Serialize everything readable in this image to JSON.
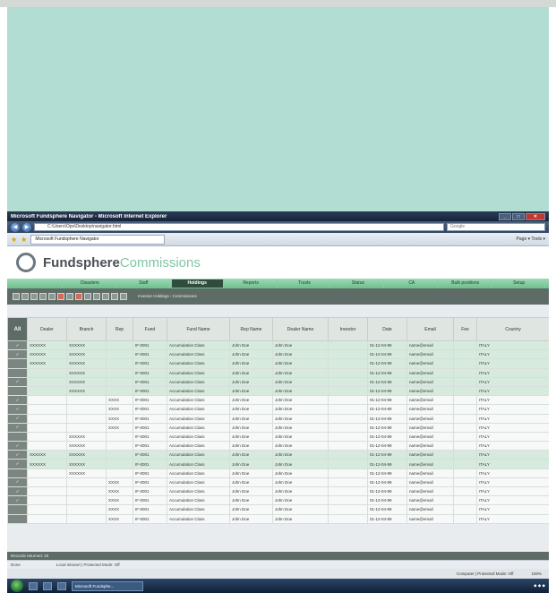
{
  "window": {
    "title": "Microsoft Fundsphere Navigator - Microsoft Internet Explorer",
    "address": "C:\\Users\\Ops\\Desktop\\navigator.html",
    "search_placeholder": "Google",
    "tab_label": "Microsoft Fundsphere Navigator",
    "tab_tools": "Page ▾  Tools ▾"
  },
  "app": {
    "brand_name": "Fundsphere",
    "brand_suffix": "Commissions",
    "menu": [
      "",
      "Disasters",
      "Staff",
      "Holdings",
      "Reports",
      "Trusts",
      "Status",
      "CA",
      "Bulk positions",
      "Setup"
    ],
    "active_menu": "Holdings",
    "breadcrumb": "Investor Holdings › Commissions"
  },
  "table": {
    "all_label": "All",
    "columns": [
      "Dealer",
      "Branch",
      "Rep",
      "Fund",
      "Fund Name",
      "Rep Name",
      "Dealer Name",
      "Investor",
      "Date",
      "Email",
      "Fee",
      "Country"
    ],
    "rows": [
      [
        "✓",
        "XXXXXX",
        "XXXXXX",
        "",
        "IF-0001",
        "Accumulation Class",
        "John Doe",
        "John Doe",
        "",
        "01-12-04-99",
        "name@email",
        "",
        "ITALY"
      ],
      [
        "✓",
        "XXXXXX",
        "XXXXXX",
        "",
        "IF-0001",
        "Accumulation Class",
        "John Doe",
        "John Doe",
        "",
        "01-12-04-99",
        "name@email",
        "",
        "ITALY"
      ],
      [
        "",
        "XXXXXX",
        "XXXXXX",
        "",
        "IF-0001",
        "Accumulation Class",
        "John Doe",
        "John Doe",
        "",
        "01-12-04-99",
        "name@email",
        "",
        "ITALY"
      ],
      [
        "",
        "",
        "XXXXXX",
        "",
        "IF-0001",
        "Accumulation Class",
        "John Doe",
        "John Doe",
        "",
        "01-12-04-99",
        "name@email",
        "",
        "ITALY"
      ],
      [
        "✓",
        "",
        "XXXXXX",
        "",
        "IF-0001",
        "Accumulation Class",
        "John Doe",
        "John Doe",
        "",
        "01-12-04-99",
        "name@email",
        "",
        "ITALY"
      ],
      [
        "",
        "",
        "XXXXXX",
        "",
        "IF-0001",
        "Accumulation Class",
        "John Doe",
        "John Doe",
        "",
        "01-12-04-99",
        "name@email",
        "",
        "ITALY"
      ],
      [
        "✓",
        "",
        "",
        "XXXX",
        "IF-0001",
        "Accumulation Class",
        "John Doe",
        "John Doe",
        "",
        "01-12-04-99",
        "name@email",
        "",
        "ITALY"
      ],
      [
        "✓",
        "",
        "",
        "XXXX",
        "IF-0001",
        "Accumulation Class",
        "John Doe",
        "John Doe",
        "",
        "01-12-04-99",
        "name@email",
        "",
        "ITALY"
      ],
      [
        "✓",
        "",
        "",
        "XXXX",
        "IF-0001",
        "Accumulation Class",
        "John Doe",
        "John Doe",
        "",
        "01-12-04-99",
        "name@email",
        "",
        "ITALY"
      ],
      [
        "✓",
        "",
        "",
        "XXXX",
        "IF-0001",
        "Accumulation Class",
        "John Doe",
        "John Doe",
        "",
        "01-12-04-99",
        "name@email",
        "",
        "ITALY"
      ],
      [
        "",
        "",
        "XXXXXX",
        "",
        "IF-0001",
        "Accumulation Class",
        "John Doe",
        "John Doe",
        "",
        "01-12-04-99",
        "name@email",
        "",
        "ITALY"
      ],
      [
        "✓",
        "",
        "XXXXXX",
        "",
        "IF-0001",
        "Accumulation Class",
        "John Doe",
        "John Doe",
        "",
        "01-12-04-99",
        "name@email",
        "",
        "ITALY"
      ],
      [
        "✓",
        "XXXXXX",
        "XXXXXX",
        "",
        "IF-0001",
        "Accumulation Class",
        "John Doe",
        "John Doe",
        "",
        "01-12-04-99",
        "name@email",
        "",
        "ITALY"
      ],
      [
        "✓",
        "XXXXXX",
        "XXXXXX",
        "",
        "IF-0001",
        "Accumulation Class",
        "John Doe",
        "John Doe",
        "",
        "01-12-04-99",
        "name@email",
        "",
        "ITALY"
      ],
      [
        "",
        "",
        "XXXXXX",
        "",
        "IF-0001",
        "Accumulation Class",
        "John Doe",
        "John Doe",
        "",
        "01-12-04-99",
        "name@email",
        "",
        "ITALY"
      ],
      [
        "✓",
        "",
        "",
        "XXXX",
        "IF-0001",
        "Accumulation Class",
        "John Doe",
        "John Doe",
        "",
        "01-12-04-99",
        "name@email",
        "",
        "ITALY"
      ],
      [
        "✓",
        "",
        "",
        "XXXX",
        "IF-0001",
        "Accumulation Class",
        "John Doe",
        "John Doe",
        "",
        "01-12-04-99",
        "name@email",
        "",
        "ITALY"
      ],
      [
        "✓",
        "",
        "",
        "XXXX",
        "IF-0001",
        "Accumulation Class",
        "John Doe",
        "John Doe",
        "",
        "01-12-04-99",
        "name@email",
        "",
        "ITALY"
      ],
      [
        "",
        "",
        "",
        "XXXX",
        "IF-0001",
        "Accumulation Class",
        "John Doe",
        "John Doe",
        "",
        "01-12-04-99",
        "name@email",
        "",
        "ITALY"
      ],
      [
        "",
        "",
        "",
        "XXXX",
        "IF-0001",
        "Accumulation Class",
        "John Doe",
        "John Doe",
        "",
        "01-12-04-99",
        "name@email",
        "",
        "ITALY"
      ]
    ],
    "row_shading": [
      "g",
      "g",
      "g",
      "g",
      "g",
      "g",
      "w",
      "w",
      "w",
      "w",
      "w",
      "w",
      "g",
      "g",
      "w",
      "w",
      "w",
      "w",
      "w",
      "w"
    ]
  },
  "status": {
    "app_status": "Records returned: 20",
    "ie_left": "Local intranet | Protected Mode: Off",
    "ie_mid": "Done",
    "zone": "Computer | Protected Mode: Off",
    "zoom": "100%"
  },
  "taskbar": {
    "app": "Microsoft Fundsphe..."
  }
}
